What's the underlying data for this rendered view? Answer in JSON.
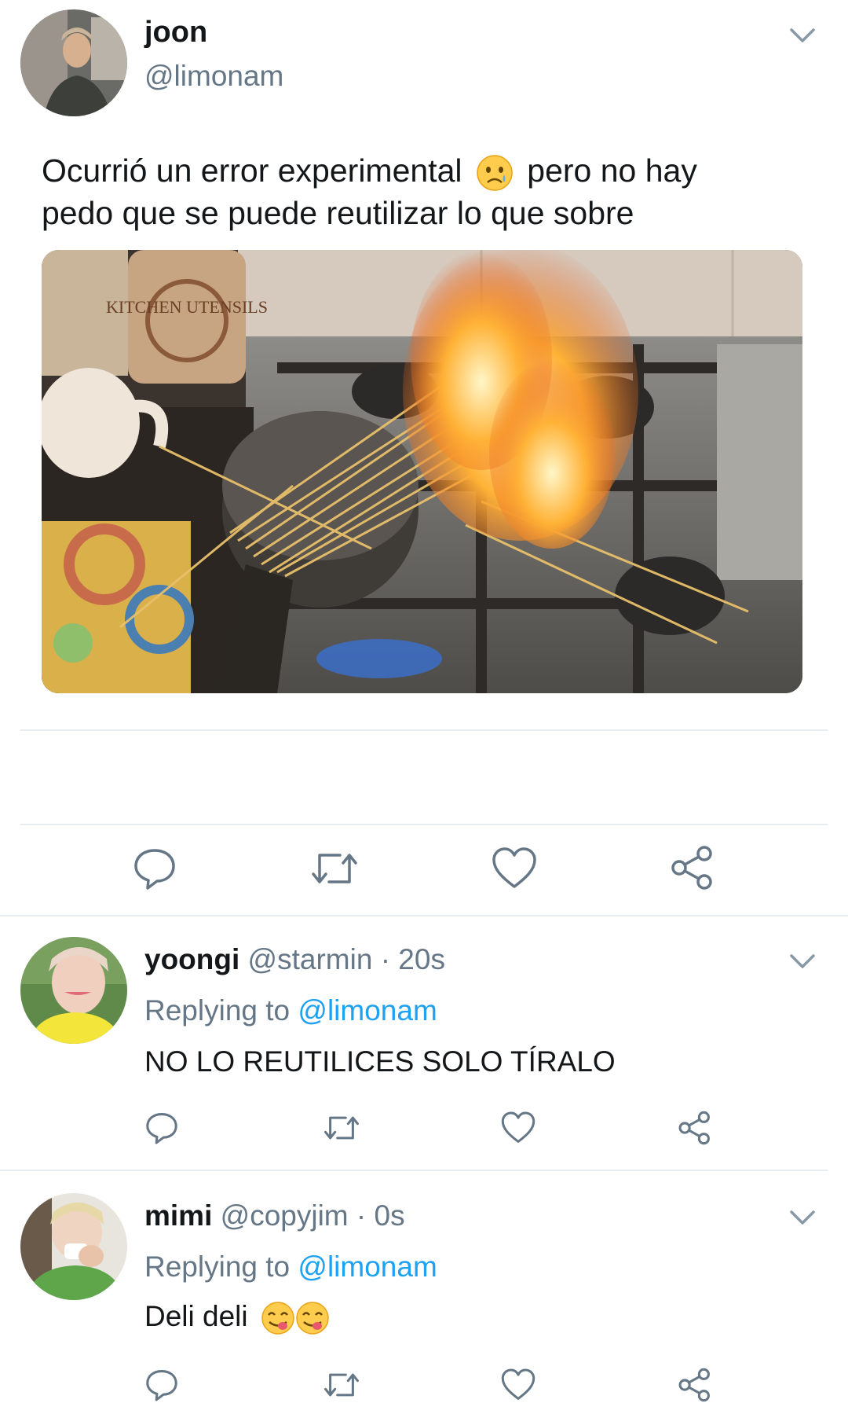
{
  "main_tweet": {
    "name": "joon",
    "handle": "@limonam",
    "text": "Ocurrió un error experimental 😥 pero no hay pedo que se puede reutilizar lo que sobre",
    "text_line1_before_emoji": "Ocurrió un error experimental",
    "text_line1_after_emoji": "pero no hay",
    "text_line2": "pedo que se puede reutilizar lo que sobre",
    "emoji": "sad-relieved-face",
    "image_label": "KITCHEN UTENSILS"
  },
  "actions": [
    "reply-icon",
    "retweet-icon",
    "like-icon",
    "share-icon"
  ],
  "replies": [
    {
      "name": "yoongi",
      "handle": "@starmin",
      "sep": "·",
      "time": "20s",
      "replying_label": "Replying to",
      "replying_to": "@limonam",
      "text": "NO LO REUTILICES SOLO TÍRALO"
    },
    {
      "name": "mimi",
      "handle": "@copyjim",
      "sep": "·",
      "time": "0s",
      "replying_label": "Replying to",
      "replying_to": "@limonam",
      "text": "Deli deli",
      "emojis": [
        "yum-face",
        "yum-face"
      ]
    }
  ],
  "colors": {
    "link": "#1da1f2",
    "muted": "#657786",
    "text": "#14171a",
    "divider": "#e6ecf0"
  }
}
